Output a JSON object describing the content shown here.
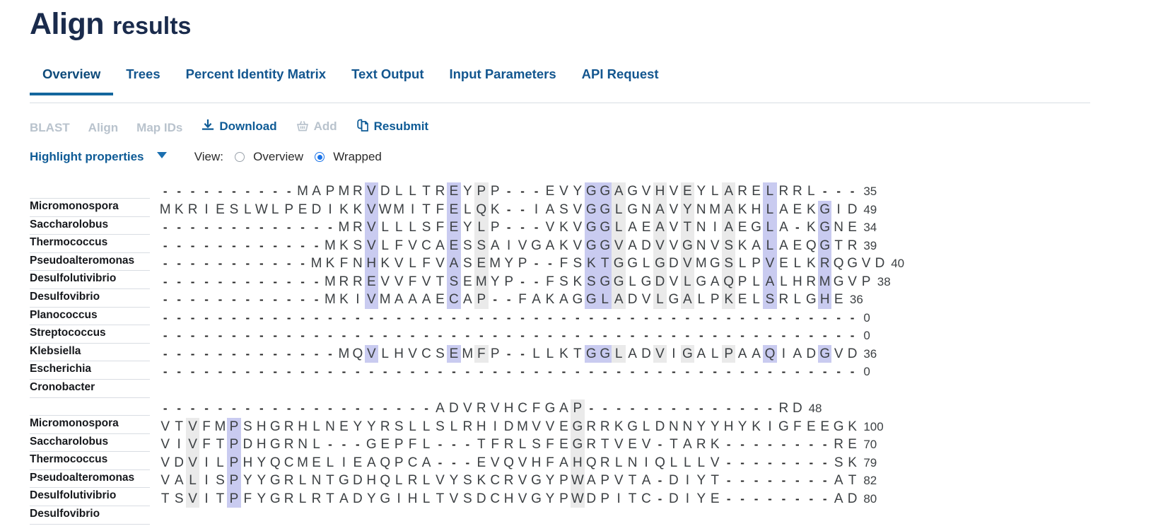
{
  "header": {
    "title_strong": "Align",
    "title_light": "results"
  },
  "tabs": [
    {
      "label": "Overview",
      "active": true
    },
    {
      "label": "Trees",
      "active": false
    },
    {
      "label": "Percent Identity Matrix",
      "active": false
    },
    {
      "label": "Text Output",
      "active": false
    },
    {
      "label": "Input Parameters",
      "active": false
    },
    {
      "label": "API Request",
      "active": false
    }
  ],
  "actions": [
    {
      "label": "BLAST",
      "icon": null,
      "disabled": true
    },
    {
      "label": "Align",
      "icon": null,
      "disabled": true
    },
    {
      "label": "Map IDs",
      "icon": null,
      "disabled": true
    },
    {
      "label": "Download",
      "icon": "download-icon",
      "disabled": false
    },
    {
      "label": "Add",
      "icon": "basket-icon",
      "disabled": true
    },
    {
      "label": "Resubmit",
      "icon": "copy-document-icon",
      "disabled": false
    }
  ],
  "options": {
    "highlight_properties_label": "Highlight properties",
    "view_label": "View:",
    "view_options": [
      {
        "label": "Overview",
        "selected": false
      },
      {
        "label": "Wrapped",
        "selected": true
      }
    ]
  },
  "colors": {
    "accent_link": "#0e5b96",
    "tab_underline": "#14679e",
    "title": "#1a2b4c",
    "radio_selected": "#1a73e8",
    "highlight_blue": "#c9cbf0",
    "highlight_grey": "#eaeaea"
  },
  "alignment": {
    "organisms": [
      "Micromonospora",
      "Saccharolobus",
      "Thermococcus",
      "Pseudoalteromonas",
      "Desulfolutivibrio",
      "Desulfovibrio",
      "Planococcus",
      "Streptococcus",
      "Klebsiella",
      "Escherichia",
      "Cronobacter"
    ],
    "blocks": [
      {
        "rows": [
          {
            "seq": "----------MAPMRVDLLTREYPP---EVYGGAGVHVEYLARELRRL---",
            "count": "35"
          },
          {
            "seq": "MKRIESLWLPEDIKKVWMITFELQK--IASVGGLGNAVYNMAKHLAEKGID",
            "count": "49"
          },
          {
            "seq": "-------------MRVLLLSFEYLP---VKVGGLAEAVTNIAEGLA-KGNE",
            "count": "34"
          },
          {
            "seq": "------------MKSVLFVCAESSAIVGAKVGGVADVVGNVSKALAEQGTR",
            "count": "39"
          },
          {
            "seq": "-----------MKFNHKVLFVASEMYP--FSKTGGLGDVMGSLPVELKRQGVD",
            "count": "40"
          },
          {
            "seq": "------------MRREVVFVTSEMYP--FSKSGGLGDVLGAQPLALHRMGVP",
            "count": "38"
          },
          {
            "seq": "------------MKIVMAAAECAP--FAKAGGLADVLGALPKELSRLGHE",
            "count": "36"
          },
          {
            "seq": "---------------------------------------------------",
            "count": "0"
          },
          {
            "seq": "---------------------------------------------------",
            "count": "0"
          },
          {
            "seq": "-------------MQVLHVCSEMFP--LLKTGGLADVIGALPAAQIADGVD",
            "count": "36"
          },
          {
            "seq": "---------------------------------------------------",
            "count": "0"
          }
        ]
      },
      {
        "rows": [
          {
            "seq": "--------------------ADVRVHCFGAP--------------RD",
            "count": "48"
          },
          {
            "seq": "VTVFMPSHGRHLNEYYRSLLSLRHIDMVVEGRRKGLDNNYYHYKIGFEEGK",
            "count": "100"
          },
          {
            "seq": "VIVFTPDHGRNL---GEPFL---TFRLSFEGRTVEV-TARK--------RE",
            "count": "70"
          },
          {
            "seq": "VDVILPHYQCMELIEAQPCA---EVQVHFAHQRLNIQLLLV--------SK",
            "count": "79"
          },
          {
            "seq": "VALISPYYGRLNTGDHQLRLVYSKCRVGYPWAPVTA-DIYT--------AT",
            "count": "82"
          },
          {
            "seq": "TSVITPFYGRLRTADYGIHLTVSDCHVGYPWDPITC-DIYE--------AD",
            "count": "80"
          }
        ]
      }
    ]
  }
}
